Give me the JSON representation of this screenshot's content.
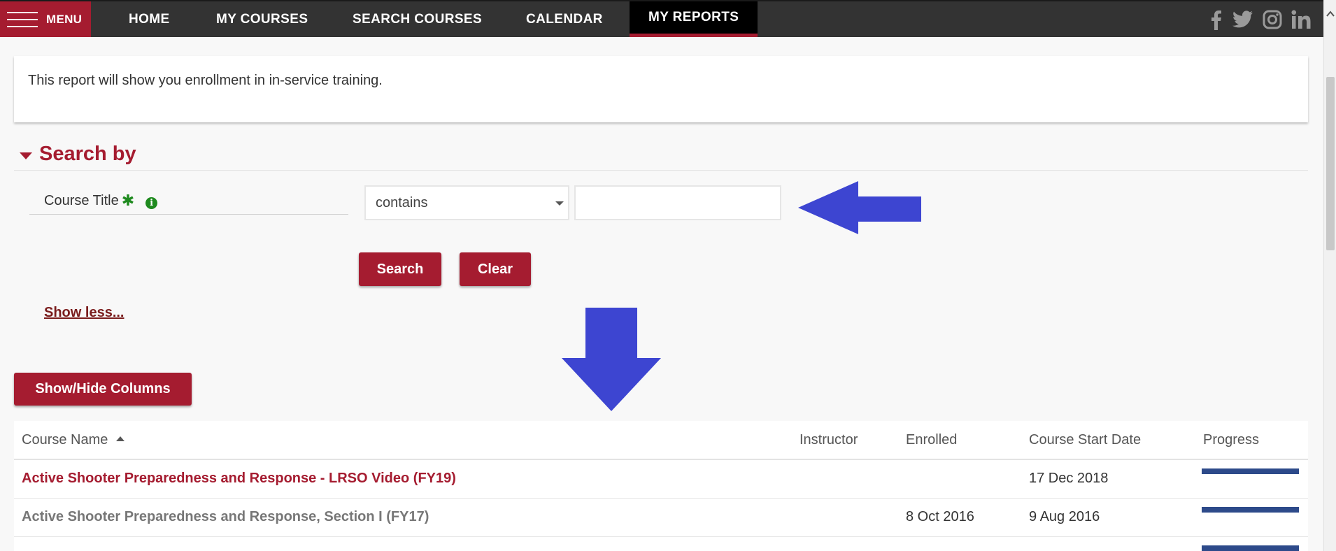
{
  "nav": {
    "menu_label": "MENU",
    "items": [
      {
        "label": "HOME"
      },
      {
        "label": "MY COURSES"
      },
      {
        "label": "SEARCH COURSES"
      },
      {
        "label": "CALENDAR"
      },
      {
        "label": "MY REPORTS",
        "active": true
      }
    ],
    "social": [
      "facebook-icon",
      "twitter-icon",
      "instagram-icon",
      "linkedin-icon"
    ]
  },
  "description": "This report will show you enrollment in in-service training.",
  "search": {
    "heading": "Search by",
    "field_label": "Course Title",
    "required_mark": "✱",
    "info_mark": "i",
    "operator_value": "contains",
    "input_value": "",
    "search_label": "Search",
    "clear_label": "Clear",
    "show_less_label": "Show less..."
  },
  "table": {
    "show_hide_label": "Show/Hide Columns",
    "columns": [
      "Course Name",
      "Instructor",
      "Enrolled",
      "Course Start Date",
      "Progress"
    ],
    "rows": [
      {
        "name": "Active Shooter Preparedness and Response - LRSO Video (FY19)",
        "instructor": "",
        "enrolled": "",
        "start": "17 Dec 2018",
        "progress": 1.0,
        "link": true
      },
      {
        "name": "Active Shooter Preparedness and Response, Section I (FY17)",
        "instructor": "",
        "enrolled": "8 Oct 2016",
        "start": "9 Aug 2016",
        "progress": 1.0,
        "link": false
      },
      {
        "name": "",
        "instructor": "",
        "enrolled": "",
        "start": "",
        "progress": 1.0,
        "link": false
      }
    ]
  },
  "colors": {
    "brand": "#a51c30",
    "nav_bg": "#333333",
    "annotation_arrow": "#3d45d1",
    "progress": "#2d4a8a"
  }
}
